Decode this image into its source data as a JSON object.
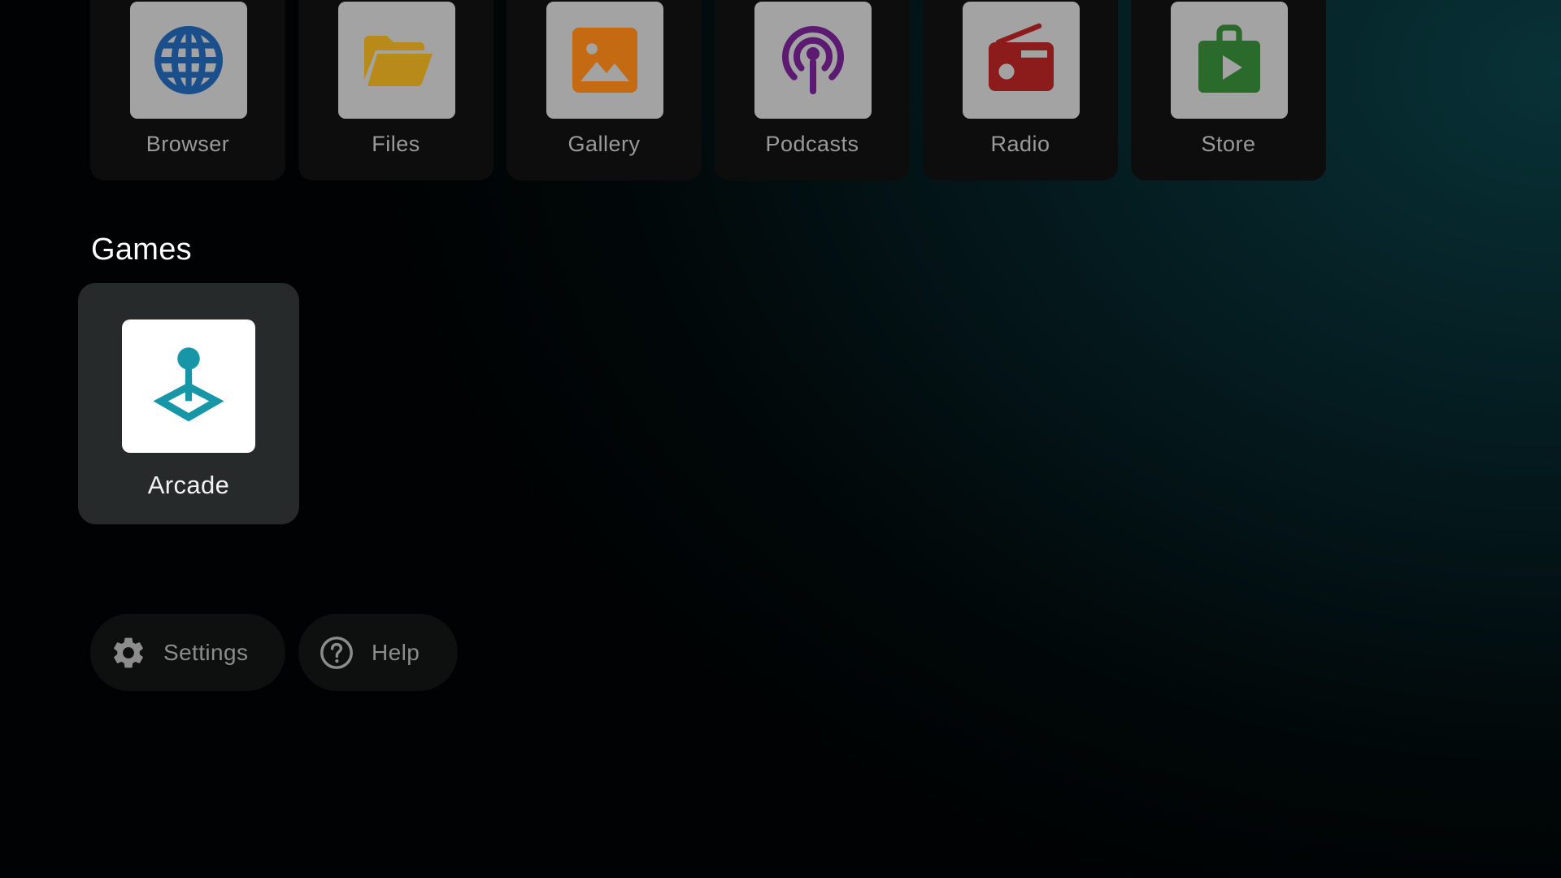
{
  "apps": [
    {
      "label": "Browser",
      "icon": "globe-icon",
      "color": "#1a4f8c"
    },
    {
      "label": "Files",
      "icon": "folder-icon",
      "color": "#b88a1a"
    },
    {
      "label": "Gallery",
      "icon": "image-icon",
      "color": "#c46a12"
    },
    {
      "label": "Podcasts",
      "icon": "podcast-icon",
      "color": "#5c1a73"
    },
    {
      "label": "Radio",
      "icon": "radio-icon",
      "color": "#8c1c1c"
    },
    {
      "label": "Store",
      "icon": "store-bag-icon",
      "color": "#2a6a2a"
    }
  ],
  "games_section": {
    "title": "Games",
    "items": [
      {
        "label": "Arcade",
        "icon": "joystick-icon",
        "color": "#1796a8",
        "focused": true
      }
    ]
  },
  "footer": {
    "settings_label": "Settings",
    "settings_icon": "gear-icon",
    "help_label": "Help",
    "help_icon": "help-circle-icon"
  },
  "colors": {
    "background_accent": "#083237",
    "card_background": "#0d0d0d",
    "focused_card_background": "#262a2b",
    "dimmed_text": "#9a9a9a"
  }
}
